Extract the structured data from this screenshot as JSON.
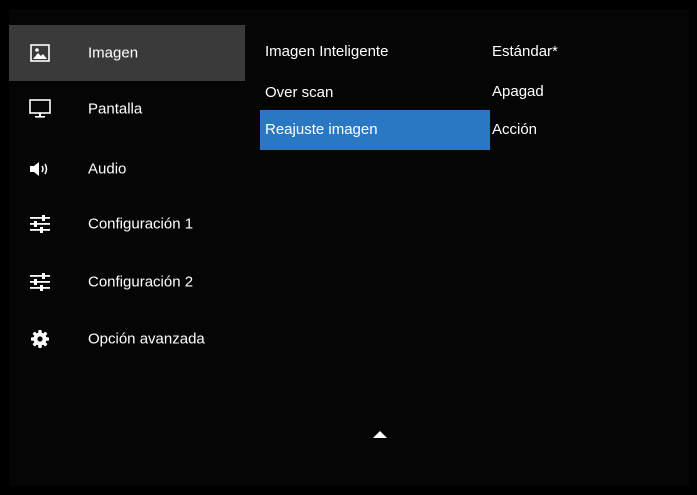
{
  "sidebar": {
    "items": [
      {
        "label": "Imagen",
        "icon": "image-icon",
        "active": true
      },
      {
        "label": "Pantalla",
        "icon": "monitor-icon",
        "active": false
      },
      {
        "label": "Audio",
        "icon": "speaker-icon",
        "active": false
      },
      {
        "label": "Configuración 1",
        "icon": "sliders-icon",
        "active": false
      },
      {
        "label": "Configuración 2",
        "icon": "sliders-icon",
        "active": false
      },
      {
        "label": "Opción avanzada",
        "icon": "gear-icon",
        "active": false
      }
    ]
  },
  "menu": {
    "rows": [
      {
        "label": "Imagen Inteligente",
        "value": "Estándar*"
      },
      {
        "label": "Over scan",
        "value": "Apagad"
      },
      {
        "label": "Reajuste imagen",
        "value": "Acción",
        "selected": true
      }
    ]
  },
  "colors": {
    "background": "#000000",
    "active_sidebar": "#3a3a3a",
    "selected_row": "#2a78c4",
    "text": "#ffffff"
  },
  "scroll_indicator": "up-arrow-icon"
}
